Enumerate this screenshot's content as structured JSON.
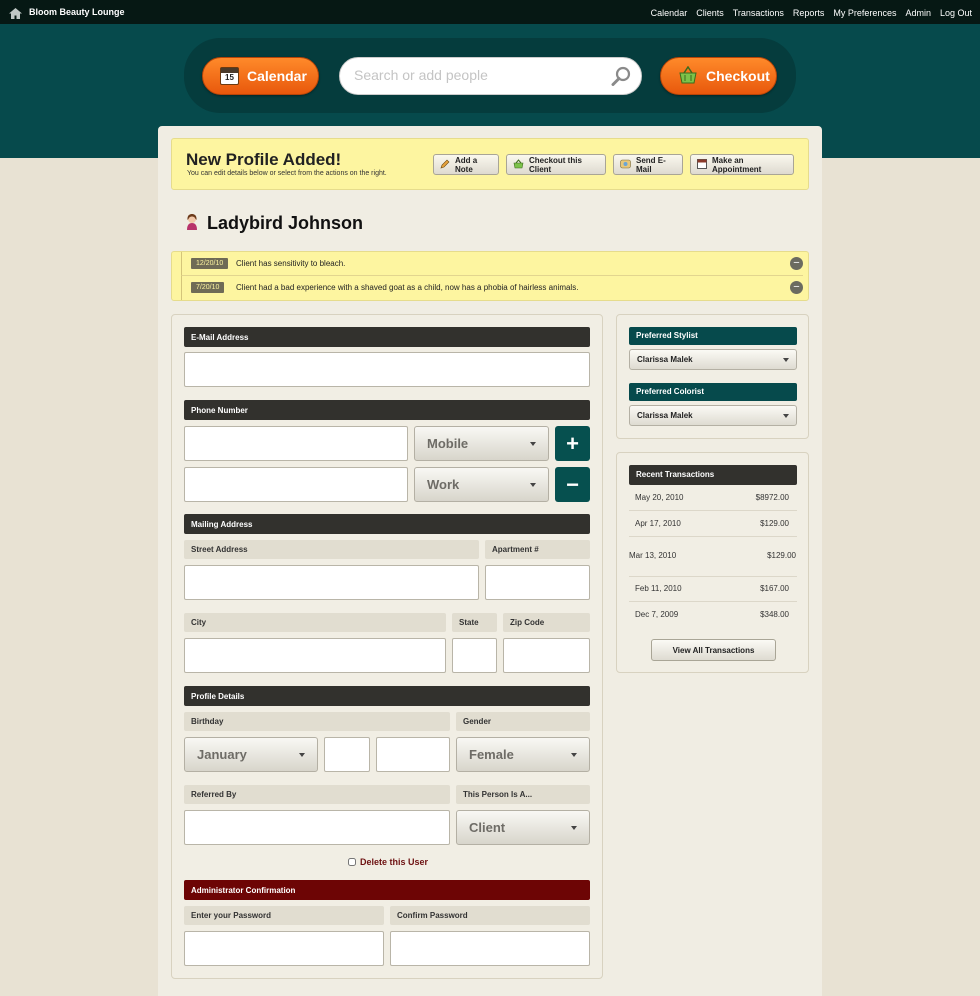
{
  "app": {
    "brand": "Bloom Beauty Lounge"
  },
  "topnav": [
    "Calendar",
    "Clients",
    "Transactions",
    "Reports",
    "My Preferences",
    "Admin",
    "Log Out"
  ],
  "toolbar": {
    "calendar_label": "Calendar",
    "calendar_day": "15",
    "search_placeholder": "Search or add people",
    "checkout_label": "Checkout"
  },
  "banner": {
    "title": "New Profile Added!",
    "subtitle": "You can edit details below or select from the actions on the right.",
    "actions": [
      "Add a Note",
      "Checkout this Client",
      "Send E-Mail",
      "Make an Appointment"
    ]
  },
  "client": {
    "name": "Ladybird Johnson"
  },
  "notes": [
    {
      "date": "12/20/10",
      "text": "Client has sensitivity to bleach."
    },
    {
      "date": "7/20/10",
      "text": "Client had a bad experience with a shaved goat as a child, now has a phobia of hairless animals."
    }
  ],
  "form": {
    "email_header": "E-Mail Address",
    "email_value": "",
    "phone_header": "Phone Number",
    "phones": [
      {
        "number": "",
        "type": "Mobile"
      },
      {
        "number": "",
        "type": "Work"
      }
    ],
    "mailing_header": "Mailing Address",
    "street_label": "Street Address",
    "apartment_label": "Apartment #",
    "city_label": "City",
    "state_label": "State",
    "zip_label": "Zip Code",
    "profile_header": "Profile Details",
    "birthday_label": "Birthday",
    "birthday_month": "January",
    "gender_label": "Gender",
    "gender_value": "Female",
    "referred_label": "Referred By",
    "person_type_label": "This Person Is A...",
    "person_type_value": "Client",
    "delete_label": "Delete this User",
    "admin_header": "Administrator Confirmation",
    "password_label": "Enter your Password",
    "confirm_label": "Confirm Password"
  },
  "sidebar": {
    "stylist_header": "Preferred Stylist",
    "stylist_value": "Clarissa Malek",
    "colorist_header": "Preferred Colorist",
    "colorist_value": "Clarissa Malek",
    "transactions_header": "Recent Transactions",
    "transactions": [
      {
        "date": "May 20, 2010",
        "amount": "$8972.00"
      },
      {
        "date": "Apr 17, 2010",
        "amount": "$129.00"
      },
      {
        "date": "Mar 13, 2010",
        "amount": "$129.00"
      },
      {
        "date": "Feb 11, 2010",
        "amount": "$167.00"
      },
      {
        "date": "Dec 7, 2009",
        "amount": "$348.00"
      }
    ],
    "view_all_label": "View All Transactions"
  },
  "colors": {
    "teal": "#064a4c",
    "orange": "#f26b12",
    "dark_header": "#32312d",
    "admin_red": "#6d0505",
    "note_yellow": "#fdf5a0"
  }
}
